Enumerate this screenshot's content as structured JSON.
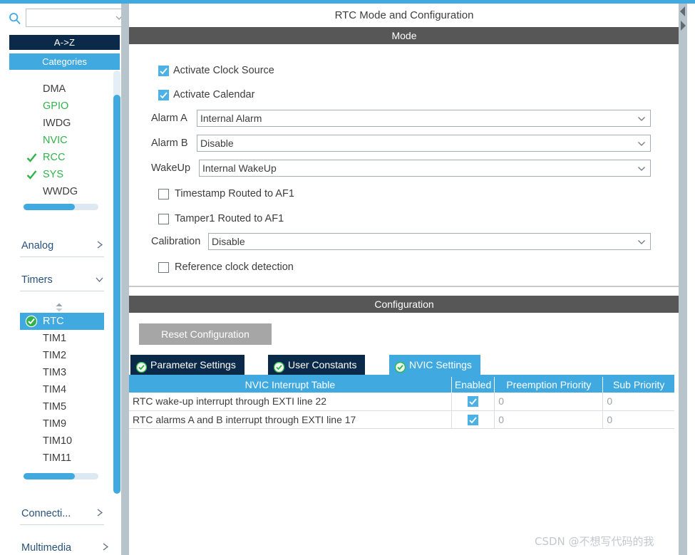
{
  "search": {
    "value": "",
    "placeholder": "",
    "icon": "search-icon",
    "chevron": "chevron-down-icon"
  },
  "sidebar": {
    "sort_button": "A->Z",
    "categories_button": "Categories",
    "peripherals": [
      {
        "label": "DMA",
        "checked": false,
        "green": false
      },
      {
        "label": "GPIO",
        "checked": false,
        "green": true
      },
      {
        "label": "IWDG",
        "checked": false,
        "green": false
      },
      {
        "label": "NVIC",
        "checked": false,
        "green": true
      },
      {
        "label": "RCC",
        "checked": true,
        "green": true
      },
      {
        "label": "SYS",
        "checked": true,
        "green": true
      },
      {
        "label": "WWDG",
        "checked": false,
        "green": false
      }
    ],
    "groups": [
      {
        "label": "Analog",
        "expanded": false,
        "arrow": "chevron-right-icon"
      },
      {
        "label": "Timers",
        "expanded": true,
        "arrow": "chevron-down-icon"
      },
      {
        "label": "Connecti...",
        "expanded": false,
        "arrow": "chevron-right-icon"
      },
      {
        "label": "Multimedia",
        "expanded": false,
        "arrow": "chevron-right-icon"
      }
    ],
    "timers": [
      {
        "label": "RTC",
        "selected": true,
        "configured": true
      },
      {
        "label": "TIM1",
        "selected": false,
        "configured": false
      },
      {
        "label": "TIM2",
        "selected": false,
        "configured": false
      },
      {
        "label": "TIM3",
        "selected": false,
        "configured": false
      },
      {
        "label": "TIM4",
        "selected": false,
        "configured": false
      },
      {
        "label": "TIM5",
        "selected": false,
        "configured": false
      },
      {
        "label": "TIM9",
        "selected": false,
        "configured": false
      },
      {
        "label": "TIM10",
        "selected": false,
        "configured": false
      },
      {
        "label": "TIM11",
        "selected": false,
        "configured": false
      }
    ]
  },
  "panel": {
    "title": "RTC Mode and Configuration",
    "mode_header": "Mode",
    "configuration_header": "Configuration"
  },
  "mode": {
    "checkboxes": [
      {
        "label": "Activate Clock Source",
        "checked": true
      },
      {
        "label": "Activate Calendar",
        "checked": true
      }
    ],
    "fields": [
      {
        "label": "Alarm A",
        "value": "Internal Alarm"
      },
      {
        "label": "Alarm B",
        "value": "Disable"
      },
      {
        "label": "WakeUp",
        "value": "Internal WakeUp"
      },
      {
        "label": "Calibration",
        "value": "Disable"
      }
    ],
    "extra_checkboxes": [
      {
        "label": "Timestamp Routed to AF1",
        "checked": false
      },
      {
        "label": "Tamper1 Routed to AF1",
        "checked": false
      },
      {
        "label": "Reference clock detection",
        "checked": false
      }
    ]
  },
  "configuration": {
    "reset_button": "Reset Configuration",
    "tabs": [
      {
        "label": "Parameter Settings",
        "active": false,
        "icon": "check-circle-icon"
      },
      {
        "label": "User Constants",
        "active": false,
        "icon": "check-circle-icon"
      },
      {
        "label": "NVIC Settings",
        "active": true,
        "icon": "check-circle-icon"
      }
    ],
    "table": {
      "headers": [
        "NVIC Interrupt Table",
        "Enabled",
        "Preemption Priority",
        "Sub Priority"
      ],
      "rows": [
        {
          "name": "RTC wake-up interrupt through EXTI line 22",
          "enabled": true,
          "preemption": "0",
          "sub": "0"
        },
        {
          "name": "RTC alarms A and B interrupt through EXTI line 17",
          "enabled": true,
          "preemption": "0",
          "sub": "0"
        }
      ]
    }
  },
  "watermark": "CSDN @不想写代码的我",
  "colors": {
    "accent_blue": "#3fa9e0",
    "navy": "#0b2948",
    "section_gray": "#575757",
    "green": "#2fb34a",
    "splitter": "#b8c4cc"
  }
}
